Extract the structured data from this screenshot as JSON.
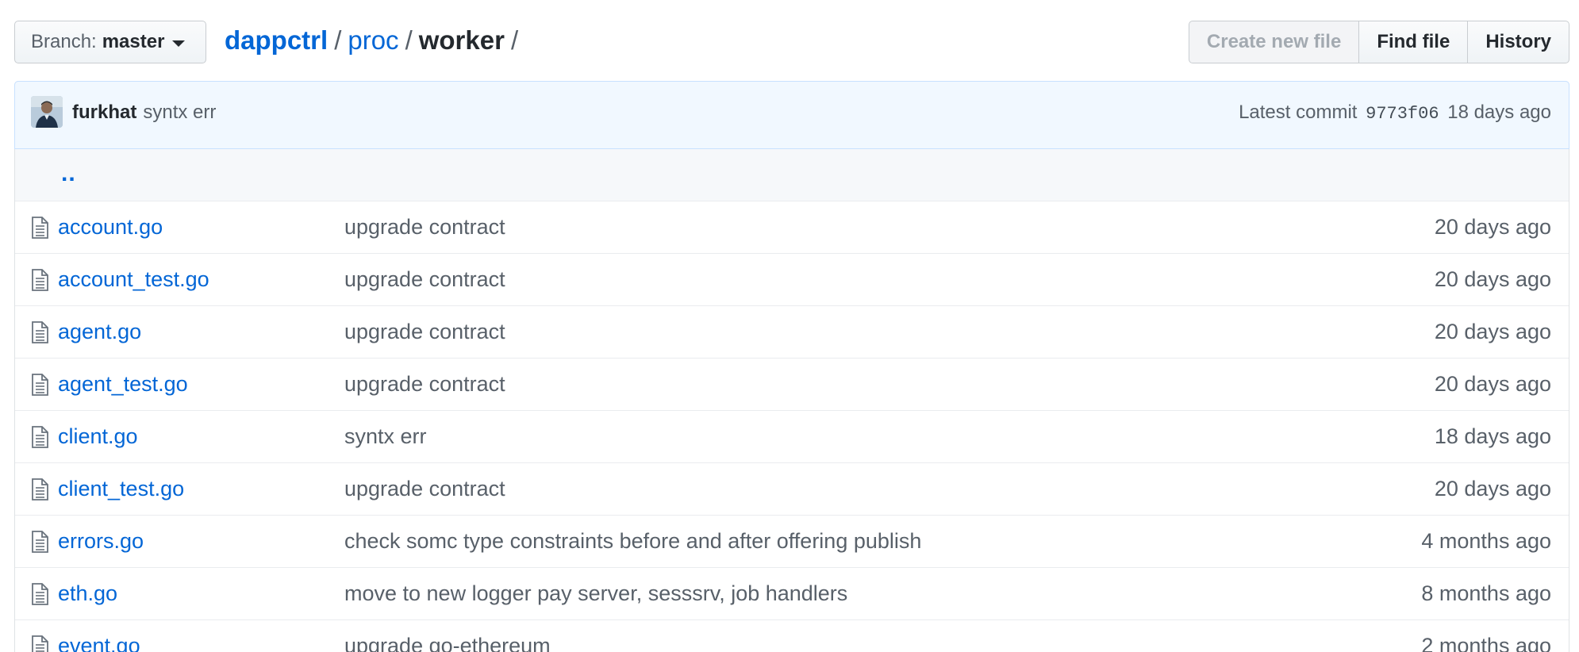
{
  "branch": {
    "label": "Branch:",
    "name": "master"
  },
  "breadcrumb": {
    "repo": "dappctrl",
    "dir1": "proc",
    "current": "worker",
    "separator": "/"
  },
  "actions": {
    "create_new_file": "Create new file",
    "find_file": "Find file",
    "history": "History"
  },
  "latest_commit": {
    "author": "furkhat",
    "message": "syntx err",
    "label": "Latest commit",
    "sha": "9773f06",
    "age": "18 days ago"
  },
  "up_link": "..",
  "files": [
    {
      "name": "account.go",
      "message": "upgrade contract",
      "age": "20 days ago"
    },
    {
      "name": "account_test.go",
      "message": "upgrade contract",
      "age": "20 days ago"
    },
    {
      "name": "agent.go",
      "message": "upgrade contract",
      "age": "20 days ago"
    },
    {
      "name": "agent_test.go",
      "message": "upgrade contract",
      "age": "20 days ago"
    },
    {
      "name": "client.go",
      "message": "syntx err",
      "age": "18 days ago"
    },
    {
      "name": "client_test.go",
      "message": "upgrade contract",
      "age": "20 days ago"
    },
    {
      "name": "errors.go",
      "message": "check somc type constraints before and after offering publish",
      "age": "4 months ago"
    },
    {
      "name": "eth.go",
      "message": "move to new logger pay server, sesssrv, job handlers",
      "age": "8 months ago"
    },
    {
      "name": "event.go",
      "message": "upgrade go-ethereum",
      "age": "2 months ago"
    }
  ],
  "colors": {
    "link": "#0366d6",
    "muted": "#586069",
    "commit_bg": "#f1f8ff"
  }
}
